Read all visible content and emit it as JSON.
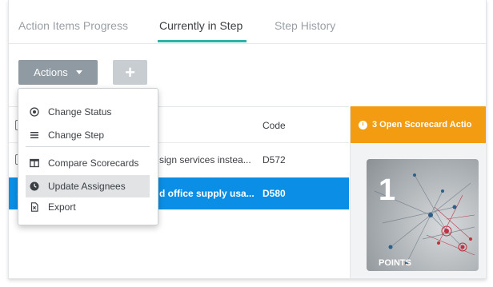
{
  "tabs": [
    {
      "label": "Action Items Progress"
    },
    {
      "label": "Currently in Step"
    },
    {
      "label": "Step History"
    }
  ],
  "toolbar": {
    "actions_label": "Actions",
    "add_label": "+"
  },
  "table": {
    "code_header": "Code",
    "rows": [
      {
        "text": "sign services instea...",
        "code": "D572"
      },
      {
        "text": "d office supply usa...",
        "code": "D580"
      }
    ]
  },
  "menu": {
    "items": [
      {
        "label": "Change Status",
        "icon": "radio-dot-icon"
      },
      {
        "label": "Change Step",
        "icon": "list-lines-icon"
      },
      {
        "label": "Compare Scorecards",
        "icon": "columns-icon"
      },
      {
        "label": "Update Assignees",
        "icon": "clock-icon"
      },
      {
        "label": "Export",
        "icon": "file-export-icon"
      }
    ]
  },
  "panel": {
    "banner": "3 Open Scorecard Actio",
    "points_value": "1",
    "points_label": "POINTS"
  },
  "colors": {
    "accent": "#2ab3a6",
    "selected_row": "#0b8fe6",
    "banner": "#f39c12",
    "actions_button": "#8f9aa3"
  }
}
